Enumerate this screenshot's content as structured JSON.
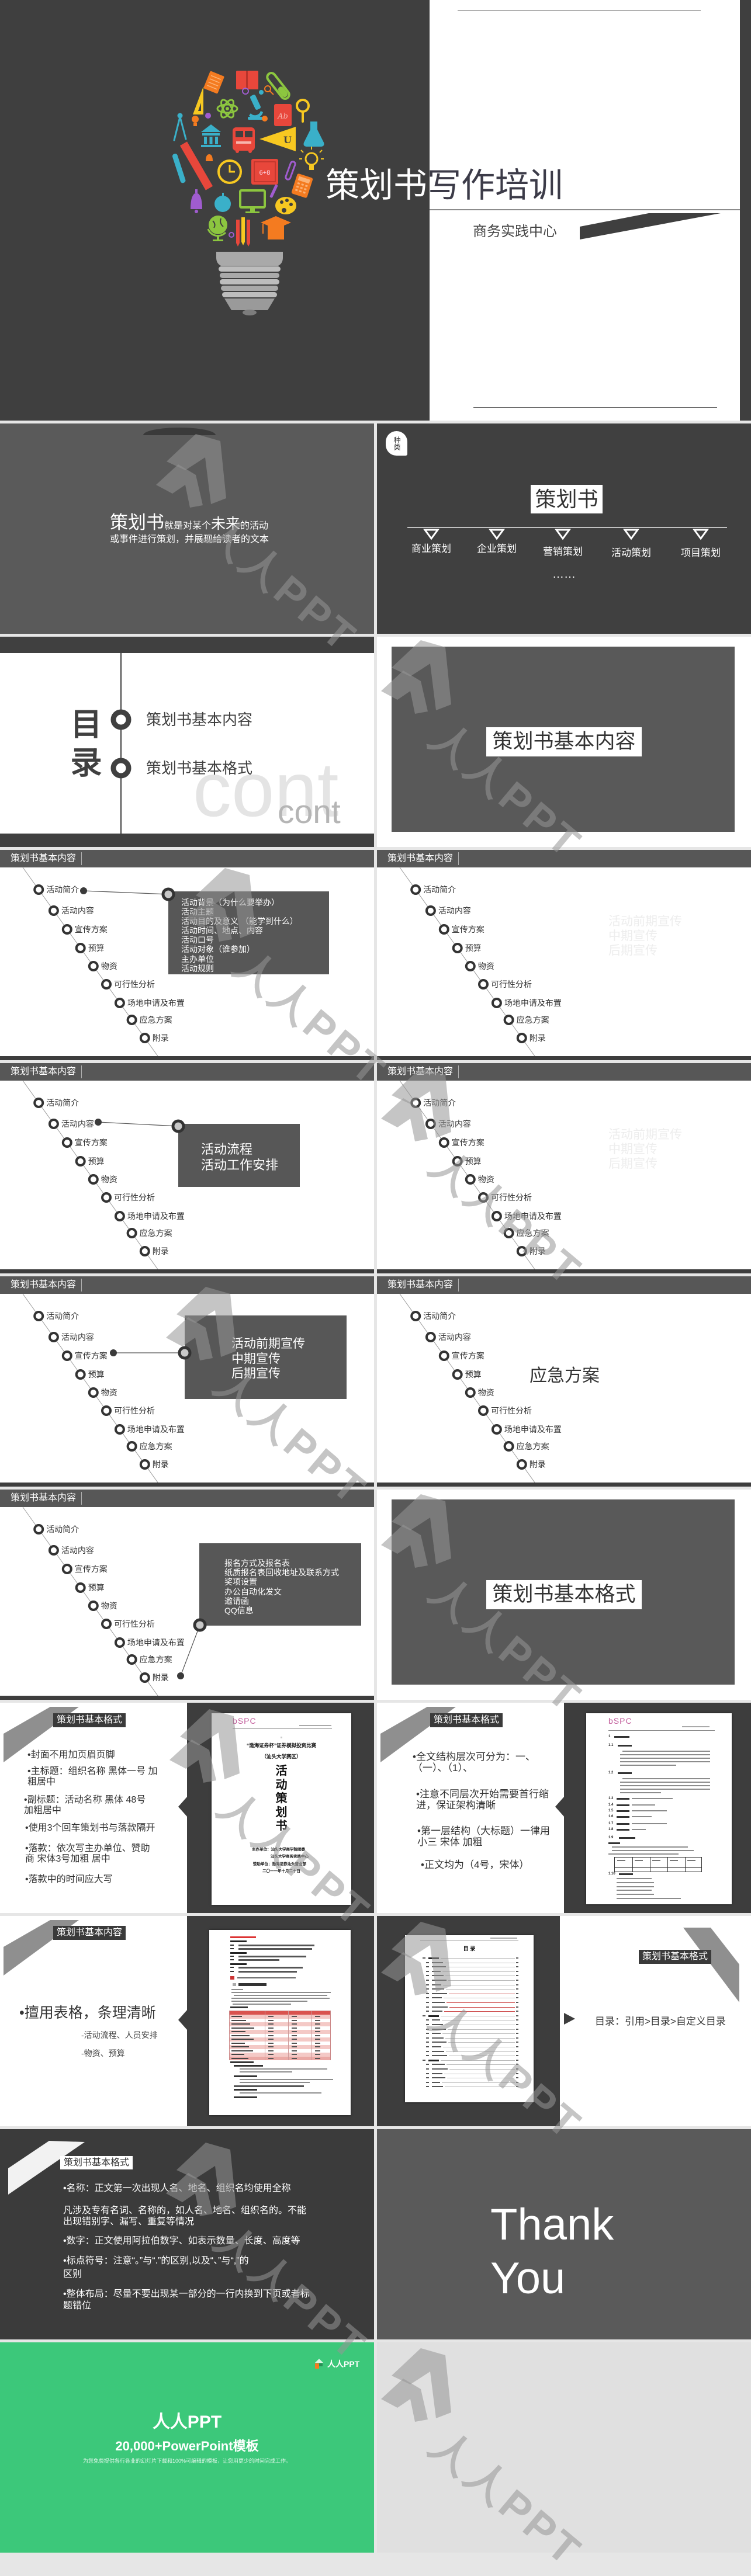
{
  "title_slide": {
    "title": "策划书写作培训",
    "subtitle": "商务实践中心"
  },
  "bulb_labels": {
    "dictionary": "Ab",
    "pennant": "U",
    "chalkboard": "6+8"
  },
  "definition_slide": {
    "term": "策划书",
    "part1": "就是对某个",
    "emphasis": "未来",
    "part2": "的活动",
    "line2": "或事件进行策划，并展现给读者的文本"
  },
  "types_slide": {
    "badge": "种类",
    "root": "策划书",
    "types": [
      "商业策划",
      "企业策划",
      "营销策划",
      "活动策划",
      "项目策划"
    ],
    "more": "……"
  },
  "toc_slide": {
    "heading": "目录",
    "items": [
      "策划书基本内容",
      "策划书基本格式"
    ],
    "deco_big": "cont",
    "deco_small": "cont"
  },
  "section_basic_content": {
    "label": "策划书基本内容"
  },
  "outline": {
    "header": "策划书基本内容",
    "items": [
      "活动简介",
      "活动内容",
      "宣传方案",
      "预算",
      "物资",
      "可行性分析",
      "场地申请及布置",
      "应急方案",
      "附录"
    ]
  },
  "outline_slides": [
    {
      "type": "callout",
      "anchor": 0,
      "lines": [
        "活动背景（为什么要举办）",
        "活动主题",
        "活动目的及意义 （能学到什么）",
        "活动时间、地点、内容",
        "活动口号",
        "活动对象（谁参加）",
        "主办单位",
        "活动规则"
      ]
    },
    {
      "type": "faded",
      "lines": [
        "活动前期宣传",
        "中期宣传",
        "后期宣传"
      ]
    },
    {
      "type": "callout",
      "anchor": 1,
      "lines": [
        "活动流程",
        "活动工作安排"
      ]
    },
    {
      "type": "faded",
      "lines": [
        "活动前期宣传",
        "中期宣传",
        "后期宣传"
      ]
    },
    {
      "type": "callout",
      "anchor": 2,
      "lines": [
        "活动前期宣传",
        "中期宣传",
        "后期宣传"
      ]
    },
    {
      "type": "center",
      "text": "应急方案"
    },
    {
      "type": "callout",
      "anchor": 8,
      "lines": [
        "报名方式及报名表",
        "纸质报名表回收地址及联系方式",
        "奖项设置",
        "办公自动化发文",
        "邀请函",
        "QQ信息"
      ]
    }
  ],
  "section_basic_format": {
    "label": "策划书基本格式"
  },
  "format_cover_slide": {
    "label": "策划书基本格式",
    "bullets": [
      "•封面不用加页眉页脚",
      "•主标题：组织名称 黑体一号 加粗居中",
      "•副标题：活动名称 黑体 48号 加粗居中",
      "•使用3个回车策划书与落款隔开",
      "•落款：依次写主办单位、赞助商 宋体3号加粗 居中",
      "•落款中的时间应大写"
    ],
    "doc": {
      "logo": "bSPC",
      "title_line1": "“渤海证券杯”证券模拟投资比赛",
      "title_line2": "（汕头大学赛区）",
      "vertical_title": [
        "活",
        "动",
        "策",
        "划",
        "书"
      ],
      "sponsor_lines": [
        "主办单位：汕头大学商学院团委",
        "汕头大学商务实践中心",
        "赞助单位：渤海证券汕头营业部",
        "二〇一一年十月二十日"
      ]
    }
  },
  "format_structure_slide": {
    "label": "策划书基本格式",
    "bullets": [
      "•全文结构层次可分为：一、（一）、（1）、",
      "•注意不同层次开始需要首行缩进，保证架构清晰",
      "•第一层结构（大标题）一律用小三 宋体 加粗",
      "•正文均为（4号，宋体）"
    ],
    "doc": {
      "logo": "bSPC",
      "section_numbers": [
        "1",
        "1.1",
        "1.2",
        "1.3",
        "1.4",
        "1.5",
        "1.6",
        "1.7",
        "1.8",
        "1.9",
        "1.10"
      ]
    }
  },
  "format_table_slide": {
    "label": "策划书基本内容",
    "bullet": "•擅用表格，条理清晰",
    "sub_items": [
      "-活动流程、人员安排",
      "-物资、预算"
    ]
  },
  "format_toc_slide": {
    "label": "策划书基本格式",
    "doc_title": "目 录",
    "instruction": "目录：引用>目录>自定义目录"
  },
  "format_rules_slide": {
    "label": "策划书基本格式",
    "paragraphs": [
      "•名称：正文第一次出现人名、地名、组织名均使用全称",
      "凡涉及专有名词、名称的，如人名、地名、组织名的。不能出现错别字、漏写、重复等情况",
      "•数字：正文使用阿拉伯数字、如表示数量、长度、高度等",
      "•标点符号：注意“。”与“.”的区别,以及“、”与“,”的区别",
      "•整体布局：尽量不要出现某一部分的一行内换到下页或者标题错位"
    ]
  },
  "thanks_slide": {
    "line1": "Thank",
    "line2": "You"
  },
  "brand_slide": {
    "logo_text": "人人PPT",
    "title": "人人PPT",
    "subtitle": "20,000+PowerPoint模板",
    "tagline": "为您免费提供各行各业的幻灯片下载和100%可编辑的模板，让您用更少的时间完成工作。"
  },
  "watermark": {
    "text": "人人PPT"
  },
  "colors": {
    "dark_gray": "#3f3f3f",
    "mid_gray": "#595959",
    "brand_green": "#3cc87a",
    "title_dark": "#3c3b48"
  }
}
